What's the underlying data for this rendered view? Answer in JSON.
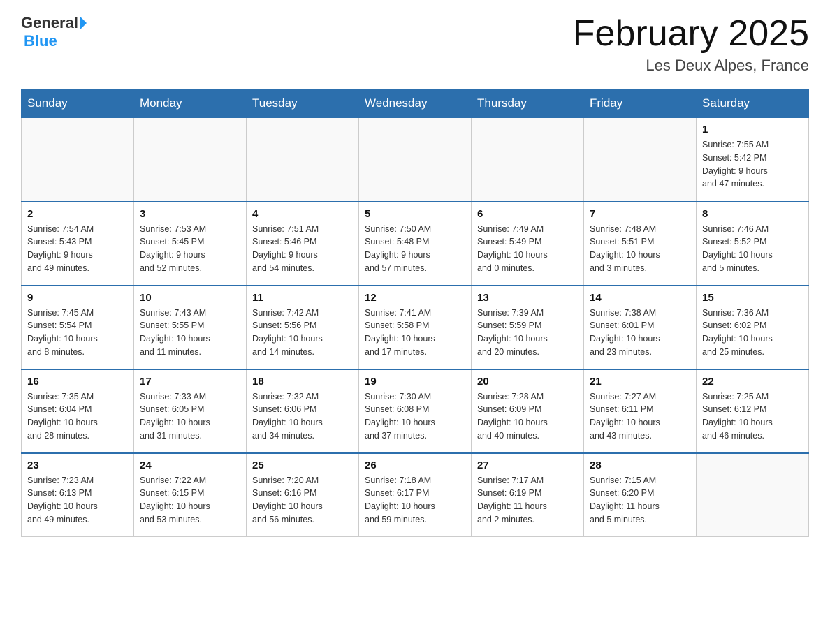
{
  "header": {
    "logo_general": "General",
    "logo_blue": "Blue",
    "month_year": "February 2025",
    "location": "Les Deux Alpes, France"
  },
  "days_of_week": [
    "Sunday",
    "Monday",
    "Tuesday",
    "Wednesday",
    "Thursday",
    "Friday",
    "Saturday"
  ],
  "weeks": [
    [
      {
        "day": "",
        "info": ""
      },
      {
        "day": "",
        "info": ""
      },
      {
        "day": "",
        "info": ""
      },
      {
        "day": "",
        "info": ""
      },
      {
        "day": "",
        "info": ""
      },
      {
        "day": "",
        "info": ""
      },
      {
        "day": "1",
        "info": "Sunrise: 7:55 AM\nSunset: 5:42 PM\nDaylight: 9 hours\nand 47 minutes."
      }
    ],
    [
      {
        "day": "2",
        "info": "Sunrise: 7:54 AM\nSunset: 5:43 PM\nDaylight: 9 hours\nand 49 minutes."
      },
      {
        "day": "3",
        "info": "Sunrise: 7:53 AM\nSunset: 5:45 PM\nDaylight: 9 hours\nand 52 minutes."
      },
      {
        "day": "4",
        "info": "Sunrise: 7:51 AM\nSunset: 5:46 PM\nDaylight: 9 hours\nand 54 minutes."
      },
      {
        "day": "5",
        "info": "Sunrise: 7:50 AM\nSunset: 5:48 PM\nDaylight: 9 hours\nand 57 minutes."
      },
      {
        "day": "6",
        "info": "Sunrise: 7:49 AM\nSunset: 5:49 PM\nDaylight: 10 hours\nand 0 minutes."
      },
      {
        "day": "7",
        "info": "Sunrise: 7:48 AM\nSunset: 5:51 PM\nDaylight: 10 hours\nand 3 minutes."
      },
      {
        "day": "8",
        "info": "Sunrise: 7:46 AM\nSunset: 5:52 PM\nDaylight: 10 hours\nand 5 minutes."
      }
    ],
    [
      {
        "day": "9",
        "info": "Sunrise: 7:45 AM\nSunset: 5:54 PM\nDaylight: 10 hours\nand 8 minutes."
      },
      {
        "day": "10",
        "info": "Sunrise: 7:43 AM\nSunset: 5:55 PM\nDaylight: 10 hours\nand 11 minutes."
      },
      {
        "day": "11",
        "info": "Sunrise: 7:42 AM\nSunset: 5:56 PM\nDaylight: 10 hours\nand 14 minutes."
      },
      {
        "day": "12",
        "info": "Sunrise: 7:41 AM\nSunset: 5:58 PM\nDaylight: 10 hours\nand 17 minutes."
      },
      {
        "day": "13",
        "info": "Sunrise: 7:39 AM\nSunset: 5:59 PM\nDaylight: 10 hours\nand 20 minutes."
      },
      {
        "day": "14",
        "info": "Sunrise: 7:38 AM\nSunset: 6:01 PM\nDaylight: 10 hours\nand 23 minutes."
      },
      {
        "day": "15",
        "info": "Sunrise: 7:36 AM\nSunset: 6:02 PM\nDaylight: 10 hours\nand 25 minutes."
      }
    ],
    [
      {
        "day": "16",
        "info": "Sunrise: 7:35 AM\nSunset: 6:04 PM\nDaylight: 10 hours\nand 28 minutes."
      },
      {
        "day": "17",
        "info": "Sunrise: 7:33 AM\nSunset: 6:05 PM\nDaylight: 10 hours\nand 31 minutes."
      },
      {
        "day": "18",
        "info": "Sunrise: 7:32 AM\nSunset: 6:06 PM\nDaylight: 10 hours\nand 34 minutes."
      },
      {
        "day": "19",
        "info": "Sunrise: 7:30 AM\nSunset: 6:08 PM\nDaylight: 10 hours\nand 37 minutes."
      },
      {
        "day": "20",
        "info": "Sunrise: 7:28 AM\nSunset: 6:09 PM\nDaylight: 10 hours\nand 40 minutes."
      },
      {
        "day": "21",
        "info": "Sunrise: 7:27 AM\nSunset: 6:11 PM\nDaylight: 10 hours\nand 43 minutes."
      },
      {
        "day": "22",
        "info": "Sunrise: 7:25 AM\nSunset: 6:12 PM\nDaylight: 10 hours\nand 46 minutes."
      }
    ],
    [
      {
        "day": "23",
        "info": "Sunrise: 7:23 AM\nSunset: 6:13 PM\nDaylight: 10 hours\nand 49 minutes."
      },
      {
        "day": "24",
        "info": "Sunrise: 7:22 AM\nSunset: 6:15 PM\nDaylight: 10 hours\nand 53 minutes."
      },
      {
        "day": "25",
        "info": "Sunrise: 7:20 AM\nSunset: 6:16 PM\nDaylight: 10 hours\nand 56 minutes."
      },
      {
        "day": "26",
        "info": "Sunrise: 7:18 AM\nSunset: 6:17 PM\nDaylight: 10 hours\nand 59 minutes."
      },
      {
        "day": "27",
        "info": "Sunrise: 7:17 AM\nSunset: 6:19 PM\nDaylight: 11 hours\nand 2 minutes."
      },
      {
        "day": "28",
        "info": "Sunrise: 7:15 AM\nSunset: 6:20 PM\nDaylight: 11 hours\nand 5 minutes."
      },
      {
        "day": "",
        "info": ""
      }
    ]
  ]
}
